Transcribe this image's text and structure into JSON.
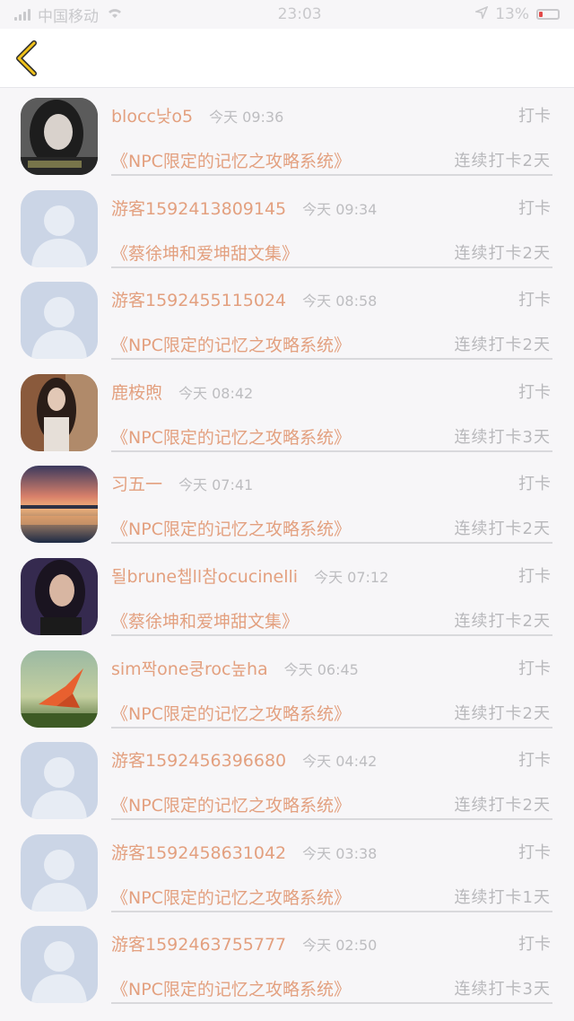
{
  "status_bar": {
    "carrier": "中国移动",
    "time": "23:03",
    "battery": "13%"
  },
  "rows": [
    {
      "username": "blocc낮o5",
      "time": "今天 09:36",
      "action": "打卡",
      "book": "《NPC限定的记忆之攻略系统》",
      "streak": "连续打卡2天",
      "avatar": "photo-woman-dark"
    },
    {
      "username": "游客1592413809145",
      "time": "今天 09:34",
      "action": "打卡",
      "book": "《蔡徐坤和爱坤甜文集》",
      "streak": "连续打卡2天",
      "avatar": "default"
    },
    {
      "username": "游客1592455115024",
      "time": "今天 08:58",
      "action": "打卡",
      "book": "《NPC限定的记忆之攻略系统》",
      "streak": "连续打卡2天",
      "avatar": "default"
    },
    {
      "username": "鹿桉煦",
      "time": "今天 08:42",
      "action": "打卡",
      "book": "《NPC限定的记忆之攻略系统》",
      "streak": "连续打卡3天",
      "avatar": "photo-woman-brown"
    },
    {
      "username": "习五一",
      "time": "今天 07:41",
      "action": "打卡",
      "book": "《NPC限定的记忆之攻略系统》",
      "streak": "连续打卡2天",
      "avatar": "photo-sunset"
    },
    {
      "username": "될brune쳅ll참ocucinelli",
      "time": "今天 07:12",
      "action": "打卡",
      "book": "《蔡徐坤和爱坤甜文集》",
      "streak": "连续打卡2天",
      "avatar": "photo-woman-purple"
    },
    {
      "username": "sim짝one쿵roc높ha",
      "time": "今天 06:45",
      "action": "打卡",
      "book": "《NPC限定的记忆之攻略系统》",
      "streak": "连续打卡2天",
      "avatar": "photo-crane"
    },
    {
      "username": "游客1592456396680",
      "time": "今天 04:42",
      "action": "打卡",
      "book": "《NPC限定的记忆之攻略系统》",
      "streak": "连续打卡2天",
      "avatar": "default"
    },
    {
      "username": "游客1592458631042",
      "time": "今天 03:38",
      "action": "打卡",
      "book": "《NPC限定的记忆之攻略系统》",
      "streak": "连续打卡1天",
      "avatar": "default"
    },
    {
      "username": "游客1592463755777",
      "time": "今天 02:50",
      "action": "打卡",
      "book": "《NPC限定的记忆之攻略系统》",
      "streak": "连续打卡3天",
      "avatar": "default"
    }
  ],
  "colors": {
    "accent": "#e3a07f",
    "muted": "#b8b8bb",
    "back_icon": "#f0c21c",
    "default_avatar_bg": "#cbd5e6",
    "default_avatar_fg": "#e7ecf4"
  }
}
